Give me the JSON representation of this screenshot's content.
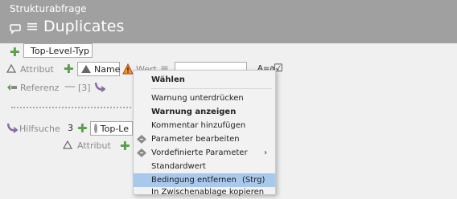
{
  "header": {
    "subtitle": "Strukturabfrage",
    "title": "≡ Duplicates"
  },
  "row1": {
    "type_label": "Top-Level-Typ"
  },
  "row2": {
    "attr_label": "Attribut",
    "name_value": "Name",
    "value_label": "Wert",
    "op": "=",
    "case_label": "A=a",
    "case_checked": "☑"
  },
  "row3": {
    "ref_label": "Referenz",
    "card": "[3]"
  },
  "row4": {
    "label": "Hilfsuche",
    "count": "3",
    "type_label": "Top-Le"
  },
  "row5": {
    "attr_label": "Attribut"
  },
  "menu": {
    "header": "Wählen",
    "items": [
      {
        "label": "Warnung unterdrücken"
      },
      {
        "label": "Warnung anzeigen"
      },
      {
        "label": "Kommentar hinzufügen"
      },
      {
        "label": "Parameter bearbeiten"
      },
      {
        "label": "Vordefinierte Parameter",
        "arrow": "›"
      },
      {
        "label": "Standardwert"
      },
      {
        "label": "Bedingung entfernen",
        "shortcut": "(Strg)"
      },
      {
        "label": "In Zwischenablage kopieren"
      }
    ]
  }
}
